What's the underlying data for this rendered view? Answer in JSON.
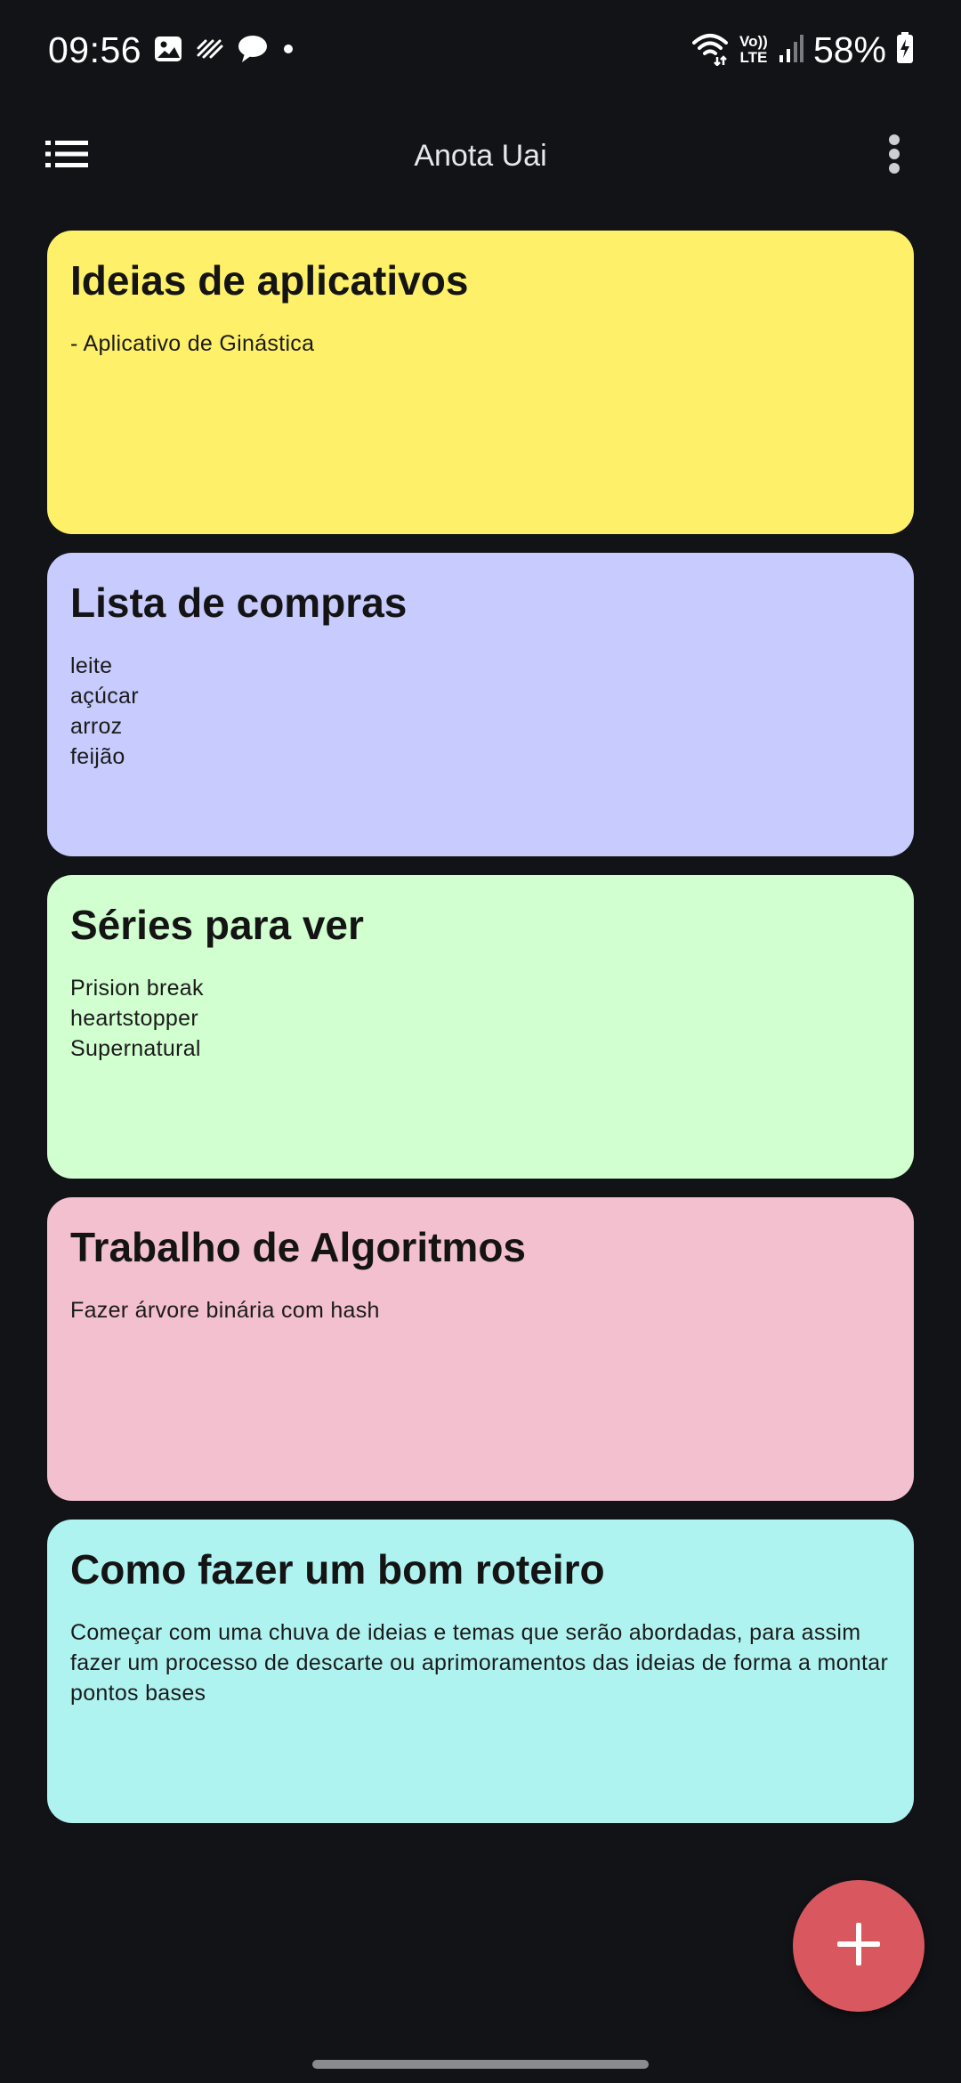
{
  "status_bar": {
    "time": "09:56",
    "battery": "58%",
    "network_label_top": "Vo))",
    "network_label_bottom": "LTE",
    "left_icons": [
      "image-icon",
      "activity-icon",
      "chat-bubble-icon",
      "dot-icon"
    ],
    "right_icons": [
      "wifi-icon",
      "signal-icon",
      "battery-charging-icon"
    ]
  },
  "app_bar": {
    "title": "Anota Uai",
    "menu_icon": "list-icon",
    "more_icon": "more-vert-icon"
  },
  "notes": [
    {
      "title": "Ideias de aplicativos",
      "body": "- Aplicativo de Ginástica",
      "color": "#fef068"
    },
    {
      "title": "Lista de compras",
      "body": "leite\naçúcar\narroz\nfeijão",
      "color": "#c8cbfd"
    },
    {
      "title": "Séries para ver",
      "body": "Prision break\nheartstopper\nSupernatural",
      "color": "#d1ffd0"
    },
    {
      "title": "Trabalho de Algoritmos",
      "body": "Fazer árvore binária com hash",
      "color": "#f3c0d0"
    },
    {
      "title": "Como fazer um bom roteiro",
      "body": "Começar com uma chuva de ideias e temas que serão abordadas, para assim fazer um processo de descarte ou aprimoramentos das ideias de forma a montar pontos bases",
      "color": "#aff3f1"
    }
  ],
  "fab": {
    "icon": "plus-icon",
    "color": "#d9585f"
  },
  "colors": {
    "background": "#121317"
  }
}
